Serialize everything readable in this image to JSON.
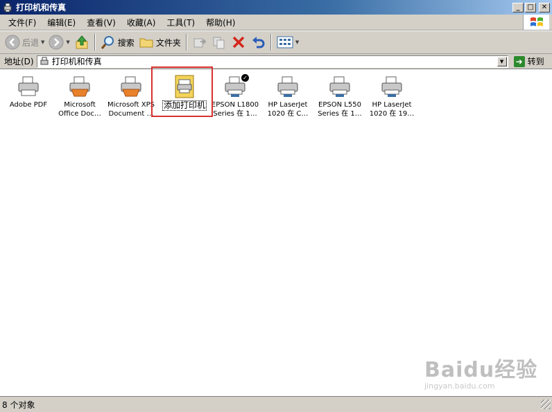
{
  "window": {
    "title": "打印机和传真"
  },
  "menubar": {
    "items": [
      "文件(F)",
      "编辑(E)",
      "查看(V)",
      "收藏(A)",
      "工具(T)",
      "帮助(H)"
    ]
  },
  "toolbar": {
    "back_label": "后退",
    "search_label": "搜索",
    "folders_label": "文件夹"
  },
  "addressbar": {
    "label": "地址(D)",
    "value": "打印机和传真",
    "go_label": "转到"
  },
  "items": [
    {
      "line1": "Adobe PDF",
      "line2": "",
      "icon": "printer-icon"
    },
    {
      "line1": "Microsoft",
      "line2": "Office Doc…",
      "icon": "printer-icon"
    },
    {
      "line1": "Microsoft XPS",
      "line2": "Document …",
      "icon": "printer-icon"
    },
    {
      "line1": "添加打印机",
      "line2": "",
      "icon": "add-printer-icon"
    },
    {
      "line1": "EPSON L1800",
      "line2": "Series 在 1…",
      "icon": "network-printer-icon"
    },
    {
      "line1": "HP LaserJet",
      "line2": "1020 在 C…",
      "icon": "network-printer-icon"
    },
    {
      "line1": "EPSON L550",
      "line2": "Series 在 1…",
      "icon": "network-printer-icon"
    },
    {
      "line1": "HP LaserJet",
      "line2": "1020 在 19…",
      "icon": "network-printer-icon"
    }
  ],
  "statusbar": {
    "text": "8 个对象"
  },
  "watermark": {
    "brand": "Baidu经验",
    "url": "jingyan.baidu.com"
  },
  "colors": {
    "titlebar_start": "#0a246a",
    "chrome": "#d4d0c8",
    "highlight": "#d83030"
  }
}
